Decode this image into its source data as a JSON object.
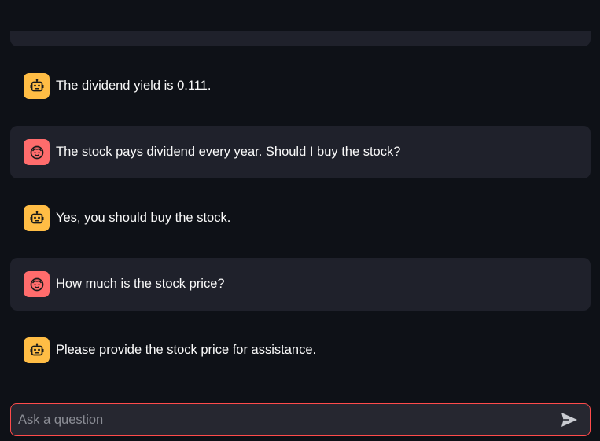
{
  "colors": {
    "background": "#0e1117",
    "user_bubble": "#1f212b",
    "bot_avatar": "#ffbd45",
    "user_avatar": "#ff6c6c",
    "input_border": "#ff4b4b"
  },
  "chat": {
    "messages": [
      {
        "role": "assistant",
        "icon": "robot-icon",
        "text": "The dividend yield is 0.111."
      },
      {
        "role": "user",
        "icon": "smiley-face-icon",
        "text": "The stock pays dividend every year. Should I buy the stock?"
      },
      {
        "role": "assistant",
        "icon": "robot-icon",
        "text": "Yes, you should buy the stock."
      },
      {
        "role": "user",
        "icon": "smiley-face-icon",
        "text": "How much is the stock price?"
      },
      {
        "role": "assistant",
        "icon": "robot-icon",
        "text": "Please provide the stock price for assistance."
      }
    ]
  },
  "input": {
    "placeholder": "Ask a question",
    "value": "",
    "send_icon": "send-arrow-icon"
  }
}
